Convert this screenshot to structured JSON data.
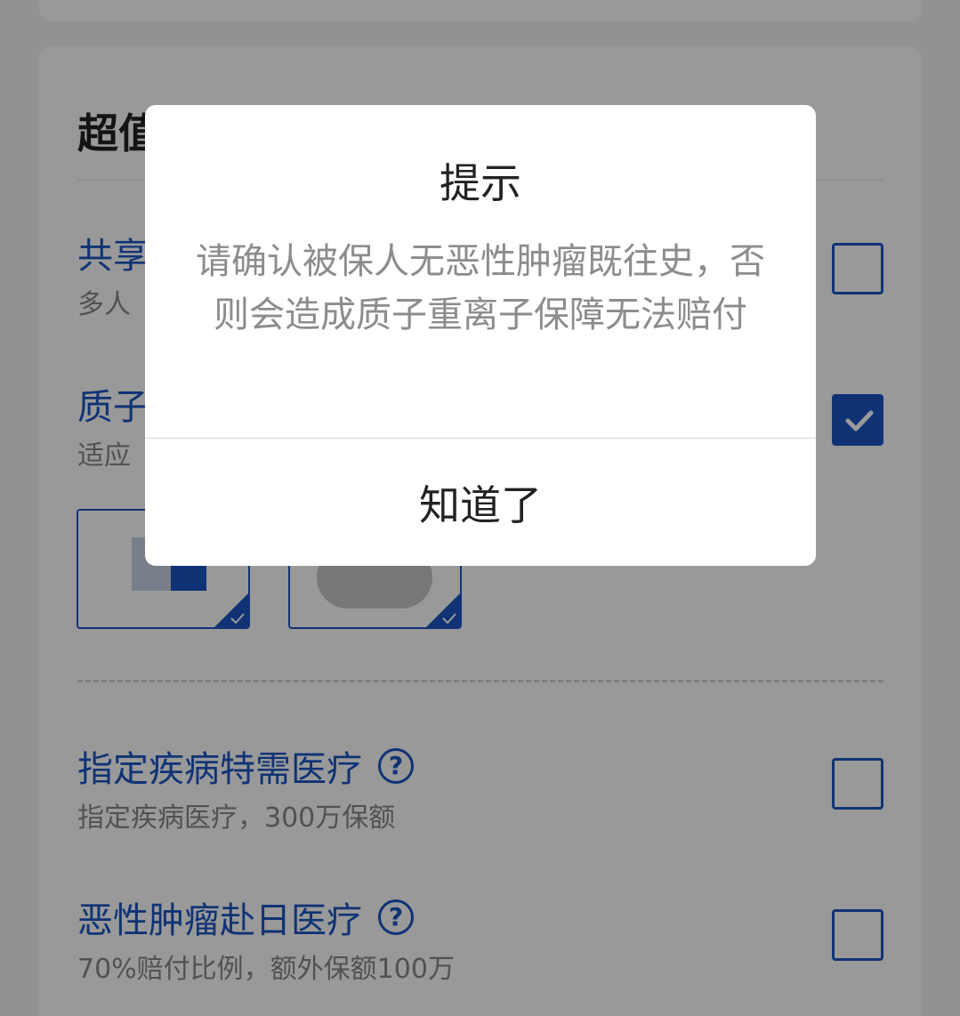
{
  "section": {
    "title": "超值"
  },
  "options": [
    {
      "title": "共享",
      "subtitle": "多人"
    },
    {
      "title": "质子",
      "subtitle": "适应"
    },
    {
      "title": "指定疾病特需医疗",
      "subtitle": "指定疾病医疗，300万保额",
      "help": "?"
    },
    {
      "title": "恶性肿瘤赴日医疗",
      "subtitle": "70%赔付比例，额外保额100万",
      "help": "?"
    }
  ],
  "colors": {
    "accent": "#1c56c4",
    "overlay": "rgba(0,0,0,0.40)"
  },
  "dialog": {
    "title": "提示",
    "message": "请确认被保人无恶性肿瘤既往史，否则会造成质子重离子保障无法赔付",
    "confirm_label": "知道了"
  },
  "icons": {
    "checkbox_checked": "checkmark-icon",
    "help": "question-circle-icon"
  }
}
